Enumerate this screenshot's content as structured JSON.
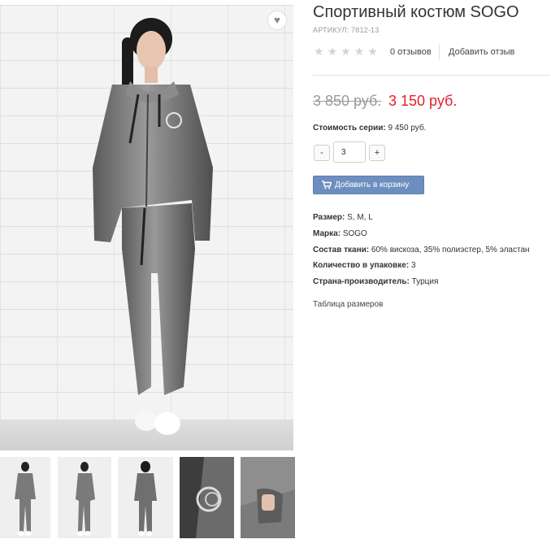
{
  "product": {
    "title": "Спортивный костюм SOGO",
    "sku": "АРТИКУЛ: 7812-13",
    "rating": {
      "value": 0,
      "max": 5
    },
    "reviews_label": "0 отзывов",
    "add_review_label": "Добавить отзыв",
    "old_price": "3 850 руб.",
    "new_price": "3 150 руб.",
    "series_label": "Стоимость серии:",
    "series_value": "9 450 руб.",
    "quantity": {
      "minus": "-",
      "value": "3",
      "plus": "+"
    },
    "add_to_cart_label": "Добавить в корзину",
    "specs": [
      {
        "label": "Размер:",
        "value": "S, M, L"
      },
      {
        "label": "Марка:",
        "value": "SOGO"
      },
      {
        "label": "Состав ткани:",
        "value": "60% вискоза, 35% полиэстер, 5% эластан"
      },
      {
        "label": "Количество в упаковке:",
        "value": "3"
      },
      {
        "label": "Страна-производитель:",
        "value": "Турция"
      }
    ],
    "size_table_label": "Таблица размеров"
  },
  "gallery": {
    "thumbnails": [
      "full-front",
      "full-side",
      "full-back",
      "detail-logo",
      "detail-pocket"
    ]
  },
  "icons": {
    "favorite": "heart-icon",
    "rating": "star-icon",
    "cart": "cart-icon"
  },
  "colors": {
    "price_new": "#e5202b",
    "price_old": "#9a9a9a",
    "button": "#6d8fbf"
  }
}
